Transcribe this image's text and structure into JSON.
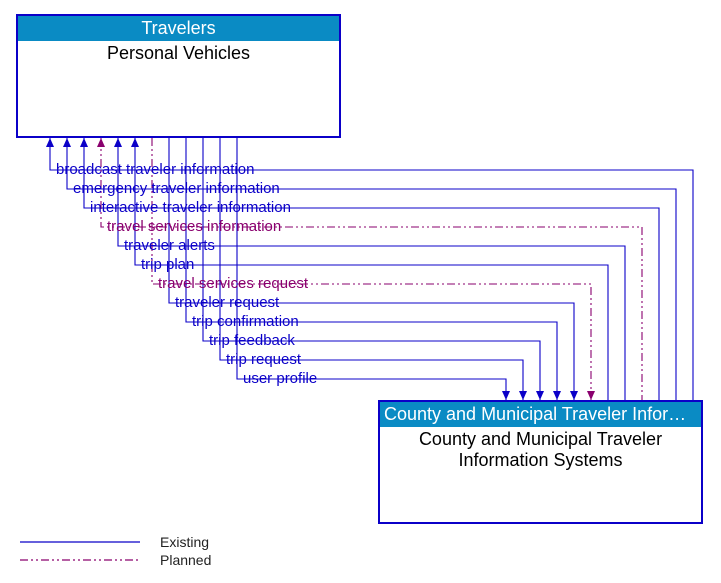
{
  "colors": {
    "existing": "#0b00c8",
    "planned": "#8a006e",
    "headerBg": "#0a8bc4",
    "border": "#0b00c8"
  },
  "nodes": {
    "top": {
      "header": "Travelers",
      "title": "Personal Vehicles"
    },
    "bottom": {
      "header": "County and Municipal Traveler Inform...",
      "title": "County and Municipal Traveler Information Systems"
    }
  },
  "flows": [
    {
      "label": "broadcast traveler information",
      "status": "existing",
      "dir": "up"
    },
    {
      "label": "emergency traveler information",
      "status": "existing",
      "dir": "up"
    },
    {
      "label": "interactive traveler information",
      "status": "existing",
      "dir": "up"
    },
    {
      "label": "travel services information",
      "status": "planned",
      "dir": "up"
    },
    {
      "label": "traveler alerts",
      "status": "existing",
      "dir": "up"
    },
    {
      "label": "trip plan",
      "status": "existing",
      "dir": "up"
    },
    {
      "label": "travel services request",
      "status": "planned",
      "dir": "down"
    },
    {
      "label": "traveler request",
      "status": "existing",
      "dir": "down"
    },
    {
      "label": "trip confirmation",
      "status": "existing",
      "dir": "down"
    },
    {
      "label": "trip feedback",
      "status": "existing",
      "dir": "down"
    },
    {
      "label": "trip request",
      "status": "existing",
      "dir": "down"
    },
    {
      "label": "user profile",
      "status": "existing",
      "dir": "down"
    }
  ],
  "legend": {
    "existing": "Existing",
    "planned": "Planned"
  }
}
